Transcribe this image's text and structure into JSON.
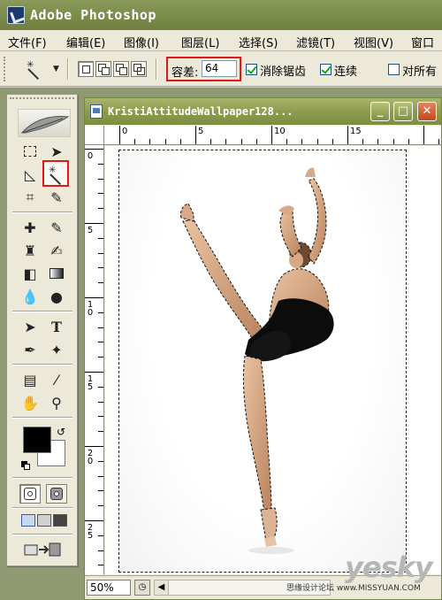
{
  "app": {
    "title": "Adobe Photoshop"
  },
  "menu": {
    "items": [
      "文件(F)",
      "编辑(E)",
      "图像(I)",
      "图层(L)",
      "选择(S)",
      "滤镜(T)",
      "视图(V)",
      "窗口"
    ]
  },
  "options": {
    "tool_icon": "magic-wand-icon",
    "tolerance_label": "容差:",
    "tolerance_value": "64",
    "anti_alias_label": "消除锯齿",
    "anti_alias_checked": true,
    "contiguous_label": "连续",
    "contiguous_checked": true,
    "all_layers_label": "对所有",
    "all_layers_checked": false,
    "highlight_color": "#e01818"
  },
  "toolbox": {
    "active_tool": "magic-wand-icon",
    "foreground_color": "#000000",
    "background_color": "#ffffff"
  },
  "document": {
    "title": "KristiAttitudeWallpaper128...",
    "zoom": "50%",
    "ruler_h_labels": [
      "0",
      "5",
      "10",
      "15"
    ],
    "ruler_v_labels": [
      "0",
      "5",
      "1 0",
      "1 5",
      "2 0",
      "2 5"
    ]
  },
  "watermark": {
    "logo": "yesky",
    "caption": "思缘设计论坛 www.MISSYUAN.COM"
  }
}
